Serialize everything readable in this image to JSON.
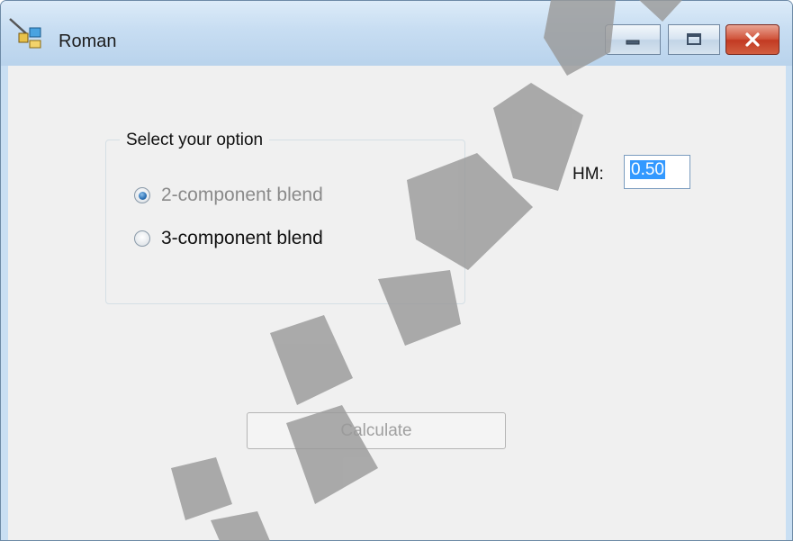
{
  "window": {
    "title": "Roman",
    "controls": [
      "minimize",
      "maximize",
      "close"
    ]
  },
  "options_group": {
    "label": "Select your option",
    "options": [
      {
        "label": "2-component blend",
        "selected": true
      },
      {
        "label": "3-component blend",
        "selected": false
      }
    ]
  },
  "hm": {
    "label": "HM:",
    "value": "0.50"
  },
  "calculate_button": {
    "label": "Calculate",
    "enabled": false
  },
  "icons": {
    "app": "app-icon",
    "minimize": "minimize-icon",
    "maximize": "maximize-icon",
    "close": "close-icon"
  },
  "colors": {
    "titlebar": "#c7ddf2",
    "client_bg": "#f0f0f0",
    "close_button": "#c23a22",
    "selection": "#3399ff",
    "watermark": "#9a9a9a"
  }
}
